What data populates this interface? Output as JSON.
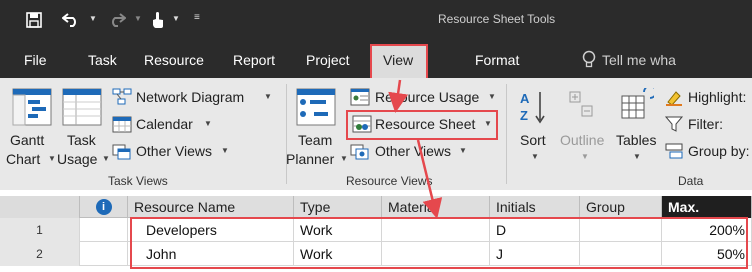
{
  "title_bar": {
    "context_title": "Resource Sheet Tools"
  },
  "tabs": [
    "File",
    "Task",
    "Resource",
    "Report",
    "Project",
    "View",
    "Format"
  ],
  "tell_me": "Tell me wha",
  "ribbon": {
    "task_views": {
      "gantt_chart_line1": "Gantt",
      "gantt_chart_line2": "Chart",
      "task_usage_line1": "Task",
      "task_usage_line2": "Usage",
      "network_diagram": "Network Diagram",
      "calendar": "Calendar",
      "other_views": "Other Views",
      "group_label": "Task Views"
    },
    "resource_views": {
      "team_planner_line1": "Team",
      "team_planner_line2": "Planner",
      "resource_usage": "Resource Usage",
      "resource_sheet": "Resource Sheet",
      "other_views": "Other Views",
      "group_label": "Resource Views"
    },
    "data": {
      "sort": "Sort",
      "outline": "Outline",
      "tables": "Tables",
      "highlight": "Highlight:",
      "filter": "Filter:",
      "group_by": "Group by:",
      "group_label": "Data"
    }
  },
  "grid": {
    "info_icon": "i",
    "columns": [
      "Resource Name",
      "Type",
      "Material",
      "Initials",
      "Group",
      "Max."
    ],
    "rows": [
      {
        "num": "1",
        "name": "Developers",
        "type": "Work",
        "material": "",
        "initials": "D",
        "group": "",
        "max": "200%"
      },
      {
        "num": "2",
        "name": "John",
        "type": "Work",
        "material": "",
        "initials": "J",
        "group": "",
        "max": "50%"
      }
    ]
  },
  "colors": {
    "dark_chrome": "#2b2b2b",
    "ribbon_bg": "#e8e8e8",
    "annotation_red": "#e5484d",
    "accent_blue": "#1e6ab8"
  }
}
